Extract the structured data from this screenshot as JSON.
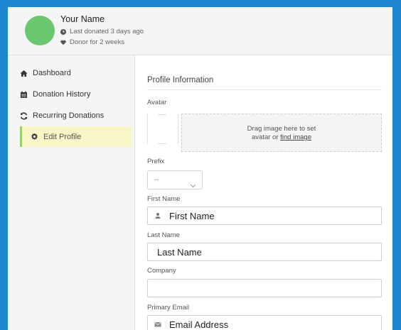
{
  "header": {
    "user_name": "Your Name",
    "last_donated": "Last donated 3 days ago",
    "donor_since": "Donor for 2 weeks",
    "avatar_color": "#6ac86e"
  },
  "sidebar": {
    "items": [
      {
        "label": "Dashboard",
        "icon": "home-icon"
      },
      {
        "label": "Donation History",
        "icon": "calendar-icon"
      },
      {
        "label": "Recurring Donations",
        "icon": "refresh-icon"
      },
      {
        "label": "Edit Profile",
        "icon": "gear-icon",
        "active": true
      }
    ],
    "active_bg": "#fbf6c8",
    "active_border": "#9fcf6a"
  },
  "form": {
    "section_title": "Profile Information",
    "avatar_label": "Avatar",
    "drop_text": "Drag image here to set",
    "drop_text2_prefix": "avatar or",
    "drop_link": "find image",
    "prefix_label": "Prefix",
    "prefix_value": "--",
    "first_name_label": "First Name",
    "first_name_placeholder": "First Name",
    "last_name_label": "Last Name",
    "last_name_placeholder": "Last Name",
    "company_label": "Company",
    "company_value": "",
    "email_label": "Primary Email",
    "email_placeholder": "Email Address"
  },
  "colors": {
    "frame_border": "#1f86d1"
  }
}
